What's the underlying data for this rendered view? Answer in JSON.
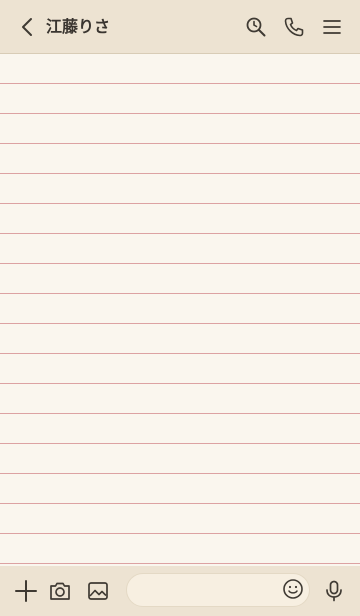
{
  "colors": {
    "header_bg": "#ede3d2",
    "chat_bg": "#faf6ee",
    "rule_line": "#dca2a2",
    "footer_bg": "#ede3d2",
    "input_bg": "#f7efe1",
    "icon": "#3f3a33",
    "title_text": "#3a3530"
  },
  "header": {
    "title": "江藤りさ",
    "back_icon": "chevron-left-icon",
    "search_icon": "search-clock-icon",
    "call_icon": "phone-icon",
    "menu_icon": "hamburger-menu-icon"
  },
  "footer": {
    "add_icon": "plus-icon",
    "camera_icon": "camera-icon",
    "image_icon": "image-icon",
    "message_placeholder": "",
    "emoji_icon": "emoji-icon",
    "mic_icon": "microphone-icon"
  }
}
